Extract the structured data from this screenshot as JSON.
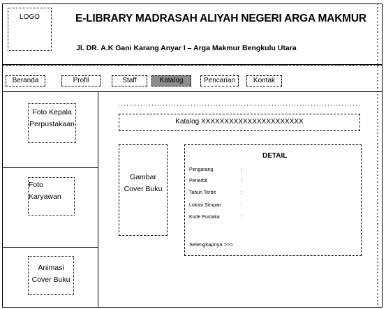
{
  "logo": "LOGO",
  "header": {
    "title": "E-LIBRARY MADRASAH ALIYAH NEGERI ARGA MAKMUR",
    "address": "Jl. DR. A.K Gani Karang Anyar I – Arga Makmur Bengkulu Utara"
  },
  "nav": {
    "items": [
      {
        "label": "Beranda"
      },
      {
        "label": "Profil"
      },
      {
        "label": "Staff"
      },
      {
        "label": "Katalog"
      },
      {
        "label": "Pencarian"
      },
      {
        "label": "Kontak"
      }
    ],
    "active": "Katalog"
  },
  "sidebar": {
    "boxes": [
      {
        "line1": "Foto Kepala",
        "line2": "Perpustakaan"
      },
      {
        "line1": "Foto",
        "line2": "Karyawan"
      },
      {
        "line1": "Animasi",
        "line2": "Cover Buku"
      }
    ]
  },
  "main": {
    "katalog_bar": "Katalog XXXXXXXXXXXXXXXXXXXXXX",
    "cover": {
      "line1": "Gambar",
      "line2": "Cover Buku"
    },
    "detail": {
      "title": "DETAIL",
      "fields": [
        {
          "label": "Pengarang",
          "sep": ":"
        },
        {
          "label": "Penerbit",
          "sep": ":"
        },
        {
          "label": "Tahun Terbit",
          "sep": ":"
        },
        {
          "label": "Lokasi Simpan",
          "sep": ":"
        },
        {
          "label": "Kode Pustaka",
          "sep": ":"
        }
      ],
      "more": "Selengkapnya >>>"
    }
  },
  "colors": {
    "active_tab": "#8c8c8c",
    "line": "#000000",
    "background": "#ffffff"
  }
}
